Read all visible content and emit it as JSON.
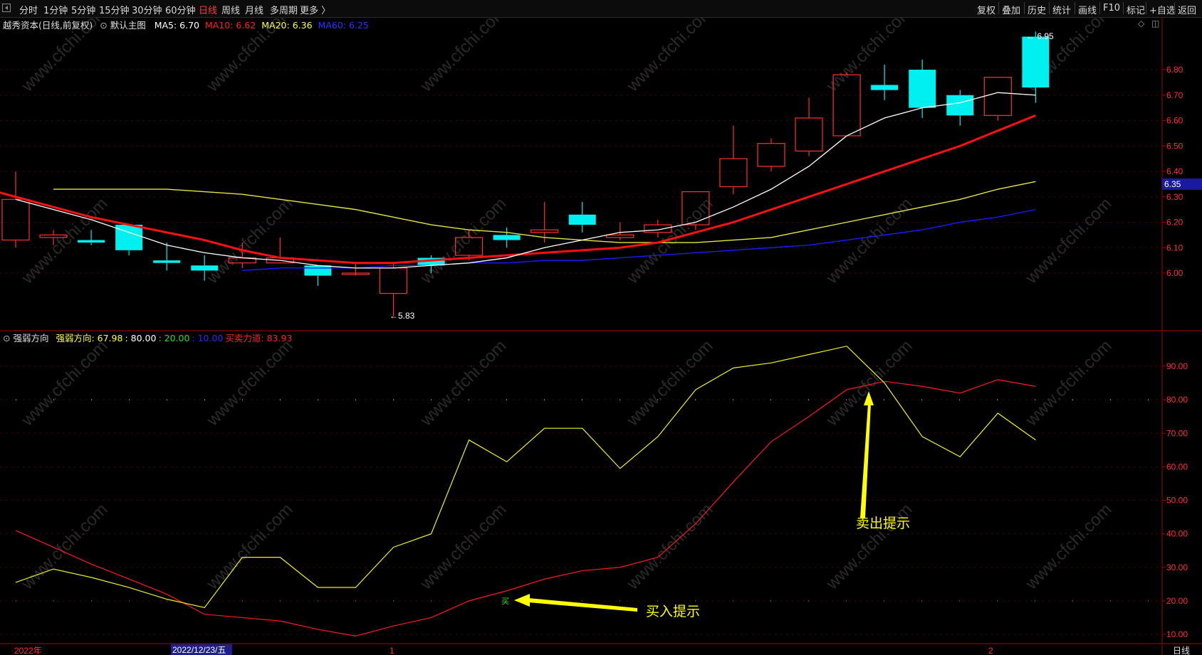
{
  "toolbar": {
    "periods": [
      "分时",
      "1分钟",
      "5分钟",
      "15分钟",
      "30分钟",
      "60分钟",
      "日线",
      "周线",
      "月线",
      "多周期",
      "更多 〉"
    ],
    "active_period": "日线",
    "right_buttons": [
      "复权",
      "叠加",
      "历史",
      "统计",
      "画线",
      "F10",
      "标记",
      "+自选",
      "返回"
    ]
  },
  "main_panel": {
    "title": "越秀资本(日线,前复权)",
    "template_label": "默认主图",
    "ma": [
      {
        "label": "MA5: 6.70",
        "color": "#ffffff"
      },
      {
        "label": "MA10: 6.62",
        "color": "#ff2020"
      },
      {
        "label": "MA20: 6.36",
        "color": "#ffff40"
      },
      {
        "label": "MA60: 6.25",
        "color": "#2a2aff"
      }
    ],
    "price_ticks": [
      "6.80",
      "6.70",
      "6.60",
      "6.50",
      "6.40",
      "6.30",
      "6.20",
      "6.10",
      "6.00"
    ],
    "current_price": "6.35",
    "high_label": "6.95",
    "low_label": "5.83"
  },
  "indicator_panel": {
    "title": "强弱方向",
    "values": [
      {
        "label": "强弱方向: 67.98",
        "color": "#ffff40"
      },
      {
        "label": ": 80.00",
        "color": "#ffffff"
      },
      {
        "label": ": 20.00",
        "color": "#20e020"
      },
      {
        "label": ": 10.00",
        "color": "#2a2aff"
      },
      {
        "label": "买卖力道: 83.93",
        "color": "#ff2020"
      }
    ],
    "ticks": [
      "90.00",
      "80.00",
      "70.00",
      "60.00",
      "50.00",
      "40.00",
      "30.00",
      "20.00",
      "10.00"
    ],
    "sell_annotation": "卖出提示",
    "buy_annotation": "买入提示",
    "buy_marker": "买"
  },
  "date_axis": {
    "labels": [
      "2022年",
      "2022/12/23/五",
      "1",
      "2"
    ],
    "period_label": "日线"
  },
  "watermark": "www.cfchi.com",
  "colors": {
    "up": "#ff3030",
    "down": "#00f0f0",
    "ma5": "#ffffff",
    "ma10": "#ff1010",
    "ma20": "#e6e640",
    "ma60": "#1a1aff",
    "grid": "#5a0000",
    "annotation": "#ffff00"
  },
  "chart_data": {
    "type": "candlestick",
    "candles": [
      {
        "o": 6.13,
        "h": 6.4,
        "l": 6.1,
        "c": 6.29
      },
      {
        "o": 6.14,
        "h": 6.17,
        "l": 6.11,
        "c": 6.15
      },
      {
        "o": 6.13,
        "h": 6.17,
        "l": 6.11,
        "c": 6.12
      },
      {
        "o": 6.19,
        "h": 6.19,
        "l": 6.07,
        "c": 6.09
      },
      {
        "o": 6.05,
        "h": 6.12,
        "l": 6.01,
        "c": 6.04
      },
      {
        "o": 6.03,
        "h": 6.07,
        "l": 5.97,
        "c": 6.01
      },
      {
        "o": 6.04,
        "h": 6.12,
        "l": 6.02,
        "c": 6.06
      },
      {
        "o": 6.04,
        "h": 6.14,
        "l": 6.04,
        "c": 6.06
      },
      {
        "o": 6.03,
        "h": 6.03,
        "l": 5.95,
        "c": 5.99
      },
      {
        "o": 6.0,
        "h": 6.04,
        "l": 5.99,
        "c": 6.0
      },
      {
        "o": 5.92,
        "h": 6.04,
        "l": 5.83,
        "c": 6.02
      },
      {
        "o": 6.06,
        "h": 6.07,
        "l": 6.0,
        "c": 6.03
      },
      {
        "o": 6.07,
        "h": 6.17,
        "l": 6.05,
        "c": 6.14
      },
      {
        "o": 6.15,
        "h": 6.18,
        "l": 6.1,
        "c": 6.13
      },
      {
        "o": 6.16,
        "h": 6.28,
        "l": 6.12,
        "c": 6.17
      },
      {
        "o": 6.23,
        "h": 6.28,
        "l": 6.16,
        "c": 6.19
      },
      {
        "o": 6.14,
        "h": 6.2,
        "l": 6.13,
        "c": 6.15
      },
      {
        "o": 6.16,
        "h": 6.21,
        "l": 6.14,
        "c": 6.19
      },
      {
        "o": 6.19,
        "h": 6.32,
        "l": 6.17,
        "c": 6.32
      },
      {
        "o": 6.34,
        "h": 6.58,
        "l": 6.31,
        "c": 6.45
      },
      {
        "o": 6.42,
        "h": 6.53,
        "l": 6.4,
        "c": 6.51
      },
      {
        "o": 6.48,
        "h": 6.69,
        "l": 6.46,
        "c": 6.61
      },
      {
        "o": 6.54,
        "h": 6.79,
        "l": 6.54,
        "c": 6.78
      },
      {
        "o": 6.74,
        "h": 6.82,
        "l": 6.68,
        "c": 6.72
      },
      {
        "o": 6.8,
        "h": 6.84,
        "l": 6.61,
        "c": 6.65
      },
      {
        "o": 6.7,
        "h": 6.72,
        "l": 6.58,
        "c": 6.62
      },
      {
        "o": 6.62,
        "h": 6.77,
        "l": 6.6,
        "c": 6.77
      },
      {
        "o": 6.93,
        "h": 6.95,
        "l": 6.67,
        "c": 6.73
      }
    ],
    "ma5": [
      6.29,
      6.25,
      6.21,
      6.16,
      6.11,
      6.08,
      6.06,
      6.05,
      6.03,
      6.02,
      6.02,
      6.03,
      6.04,
      6.06,
      6.1,
      6.13,
      6.16,
      6.17,
      6.2,
      6.26,
      6.33,
      6.42,
      6.54,
      6.61,
      6.65,
      6.67,
      6.71,
      6.7
    ],
    "ma10": [
      6.38,
      6.34,
      6.3,
      6.26,
      6.22,
      6.19,
      6.16,
      6.13,
      6.09,
      6.06,
      6.05,
      6.04,
      6.04,
      6.05,
      6.06,
      6.07,
      6.08,
      6.09,
      6.1,
      6.12,
      6.16,
      6.2,
      6.25,
      6.3,
      6.35,
      6.4,
      6.45,
      6.5,
      6.56,
      6.62
    ],
    "ma20": [
      6.33,
      6.33,
      6.33,
      6.33,
      6.32,
      6.31,
      6.29,
      6.27,
      6.25,
      6.22,
      6.19,
      6.17,
      6.16,
      6.14,
      6.13,
      6.12,
      6.12,
      6.12,
      6.13,
      6.14,
      6.17,
      6.2,
      6.23,
      6.26,
      6.29,
      6.33,
      6.36
    ],
    "ma60": [
      6.01,
      6.02,
      6.02,
      6.02,
      6.03,
      6.03,
      6.04,
      6.04,
      6.05,
      6.05,
      6.06,
      6.07,
      6.08,
      6.09,
      6.1,
      6.11,
      6.13,
      6.15,
      6.17,
      6.2,
      6.22,
      6.25
    ],
    "strength": [
      25.5,
      29.5,
      27,
      24,
      20.5,
      18,
      33,
      33,
      24,
      24,
      36,
      40,
      68,
      61.5,
      71.5,
      71.5,
      59.5,
      69,
      83,
      89.5,
      91,
      93.5,
      96,
      85,
      69,
      63,
      76,
      68
    ],
    "force": [
      41,
      36,
      31,
      26.5,
      22,
      16,
      15,
      14,
      11.5,
      9.5,
      12.5,
      15,
      20,
      23,
      26.5,
      29,
      30,
      33,
      43,
      55.5,
      67.5,
      75,
      83,
      85.5,
      84,
      82,
      86,
      84
    ]
  }
}
